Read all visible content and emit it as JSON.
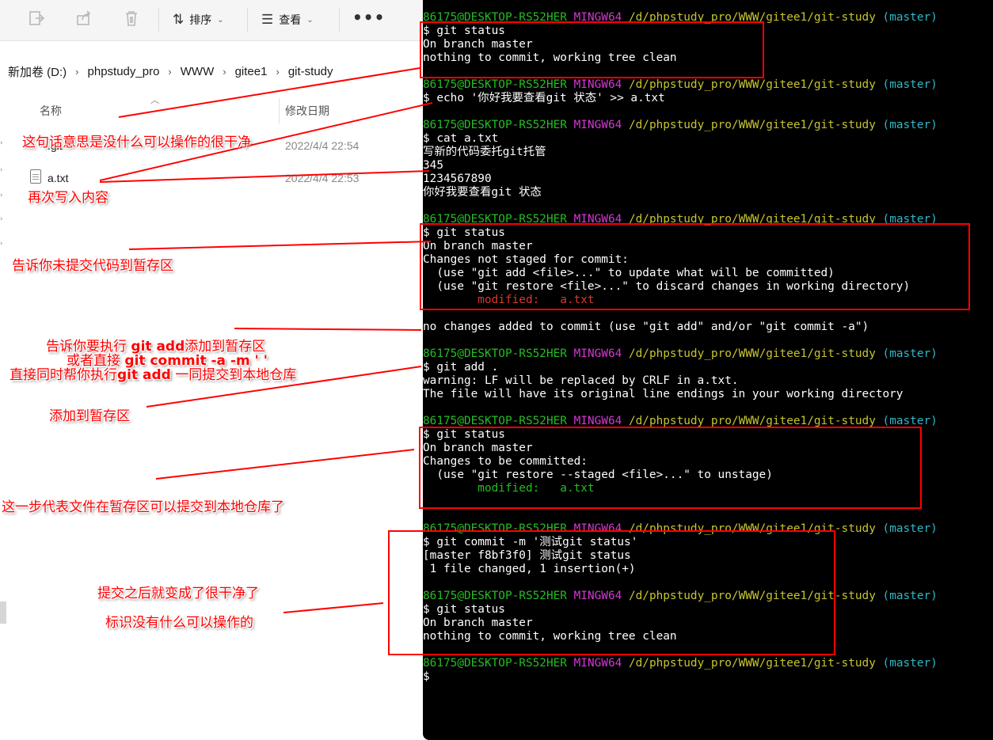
{
  "explorer": {
    "toolbar": {
      "sort_label": "排序",
      "view_label": "查看",
      "more_label": "•••"
    },
    "breadcrumb": [
      "新加卷 (D:)",
      "phpstudy_pro",
      "WWW",
      "gitee1",
      "git-study"
    ],
    "columns": {
      "name": "名称",
      "date": "修改日期"
    },
    "files": [
      {
        "name": ".git",
        "date": "2022/4/4 22:54"
      },
      {
        "name": "a.txt",
        "date": "2022/4/4 22:53"
      }
    ]
  },
  "terminal": {
    "prompt": {
      "user": "86175@DESKTOP-RS52HER",
      "env": "MINGW64",
      "path": "/d/phpstudy_pro/WWW/gitee1/git-study",
      "branch": "(master)"
    },
    "lines": [
      {
        "kind": "prompt"
      },
      {
        "kind": "text",
        "text": "$ git status"
      },
      {
        "kind": "text",
        "text": "On branch master"
      },
      {
        "kind": "text",
        "text": "nothing to commit, working tree clean"
      },
      {
        "kind": "blank"
      },
      {
        "kind": "prompt"
      },
      {
        "kind": "text",
        "text": "$ echo '你好我要查看git 状态' >> a.txt"
      },
      {
        "kind": "blank"
      },
      {
        "kind": "prompt"
      },
      {
        "kind": "text",
        "text": "$ cat a.txt"
      },
      {
        "kind": "text",
        "text": "写新的代码委托git托管"
      },
      {
        "kind": "text",
        "text": "345"
      },
      {
        "kind": "text",
        "text": "1234567890"
      },
      {
        "kind": "text",
        "text": "你好我要查看git 状态"
      },
      {
        "kind": "blank"
      },
      {
        "kind": "prompt"
      },
      {
        "kind": "text",
        "text": "$ git status"
      },
      {
        "kind": "text",
        "text": "On branch master"
      },
      {
        "kind": "text",
        "text": "Changes not staged for commit:"
      },
      {
        "kind": "text",
        "text": "  (use \"git add <file>...\" to update what will be committed)"
      },
      {
        "kind": "text",
        "text": "  (use \"git restore <file>...\" to discard changes in working directory)"
      },
      {
        "kind": "red",
        "text": "        modified:   a.txt"
      },
      {
        "kind": "blank"
      },
      {
        "kind": "text",
        "text": "no changes added to commit (use \"git add\" and/or \"git commit -a\")"
      },
      {
        "kind": "blank"
      },
      {
        "kind": "prompt"
      },
      {
        "kind": "text",
        "text": "$ git add ."
      },
      {
        "kind": "text",
        "text": "warning: LF will be replaced by CRLF in a.txt."
      },
      {
        "kind": "text",
        "text": "The file will have its original line endings in your working directory"
      },
      {
        "kind": "blank"
      },
      {
        "kind": "prompt"
      },
      {
        "kind": "text",
        "text": "$ git status"
      },
      {
        "kind": "text",
        "text": "On branch master"
      },
      {
        "kind": "text",
        "text": "Changes to be committed:"
      },
      {
        "kind": "text",
        "text": "  (use \"git restore --staged <file>...\" to unstage)"
      },
      {
        "kind": "green",
        "text": "        modified:   a.txt"
      },
      {
        "kind": "blank"
      },
      {
        "kind": "blank"
      },
      {
        "kind": "prompt"
      },
      {
        "kind": "text",
        "text": "$ git commit -m '测试git status'"
      },
      {
        "kind": "text",
        "text": "[master f8bf3f0] 测试git status"
      },
      {
        "kind": "text",
        "text": " 1 file changed, 1 insertion(+)"
      },
      {
        "kind": "blank"
      },
      {
        "kind": "prompt"
      },
      {
        "kind": "text",
        "text": "$ git status"
      },
      {
        "kind": "text",
        "text": "On branch master"
      },
      {
        "kind": "text",
        "text": "nothing to commit, working tree clean"
      },
      {
        "kind": "blank"
      },
      {
        "kind": "prompt"
      },
      {
        "kind": "text",
        "text": "$"
      }
    ]
  },
  "annotations": {
    "note1": "这句话意思是没什么可以操作的很干净",
    "note2": "再次写入内容",
    "note3": "告诉你未提交代码到暂存区",
    "note4": {
      "l1a": "告诉你要执行 ",
      "l1b": "git add",
      "l1c": "添加到暂存区",
      "l2a": "或者直接 ",
      "l2b": "git commit -a -m ' '",
      "l3a": "直接同时帮你执行",
      "l3b": "git add",
      "l3c": " 一同提交到本地仓库"
    },
    "note5": "添加到暂存区",
    "note6": "这一步代表文件在暂存区可以提交到本地仓库了",
    "note7": "提交之后就变成了很干净了",
    "note8": "标识没有什么可以操作的"
  },
  "colors": {
    "terminal_bg": "#000000",
    "prompt_user": "#25bc24",
    "prompt_env": "#d338d3",
    "prompt_path": "#c7c42f",
    "prompt_branch": "#2fb8c7",
    "annotation": "#ff0000"
  }
}
